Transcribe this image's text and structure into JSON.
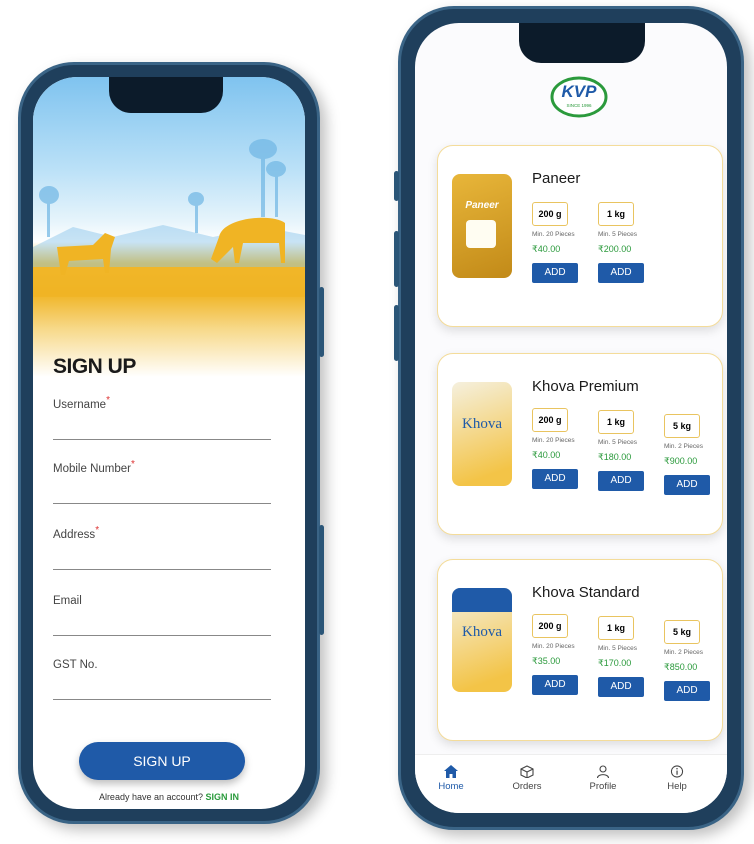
{
  "signup": {
    "title": "SIGN UP",
    "fields": [
      {
        "label": "Username",
        "required": "*"
      },
      {
        "label": "Mobile Number",
        "required": "*"
      },
      {
        "label": "Address",
        "required": "*"
      },
      {
        "label": "Email",
        "required": ""
      },
      {
        "label": "GST No.",
        "required": ""
      }
    ],
    "button_label": "SIGN UP",
    "account_prompt": "Already have an account?",
    "signin_link": "SIGN IN"
  },
  "brand": {
    "logo_text": "KVP",
    "logo_since": "SINCE 1996",
    "colors": {
      "primary": "#1f5aa8",
      "accent_green": "#2b9a3c",
      "card_border": "#f4dc9a",
      "frame": "#1f3f5c"
    }
  },
  "products": [
    {
      "name": "Paneer",
      "pack_label": "Paneer",
      "variants": [
        {
          "size": "200 g",
          "min": "Min. 20 Pieces",
          "price": "₹40.00",
          "add_label": "ADD"
        },
        {
          "size": "1 kg",
          "min": "Min. 5 Pieces",
          "price": "₹200.00",
          "add_label": "ADD"
        }
      ]
    },
    {
      "name": "Khova Premium",
      "pack_label": "Khova",
      "variants": [
        {
          "size": "200 g",
          "min": "Min. 20 Pieces",
          "price": "₹40.00",
          "add_label": "ADD"
        },
        {
          "size": "1 kg",
          "min": "Min. 5 Pieces",
          "price": "₹180.00",
          "add_label": "ADD"
        },
        {
          "size": "5 kg",
          "min": "Min. 2 Pieces",
          "price": "₹900.00",
          "add_label": "ADD"
        }
      ]
    },
    {
      "name": "Khova Standard",
      "pack_label": "Khova",
      "variants": [
        {
          "size": "200 g",
          "min": "Min. 20 Pieces",
          "price": "₹35.00",
          "add_label": "ADD"
        },
        {
          "size": "1 kg",
          "min": "Min. 5 Pieces",
          "price": "₹170.00",
          "add_label": "ADD"
        },
        {
          "size": "5 kg",
          "min": "Min. 2 Pieces",
          "price": "₹850.00",
          "add_label": "ADD"
        }
      ]
    }
  ],
  "tabs": [
    {
      "label": "Home",
      "icon": "home-icon",
      "active": true
    },
    {
      "label": "Orders",
      "icon": "box-icon",
      "active": false
    },
    {
      "label": "Profile",
      "icon": "user-icon",
      "active": false
    },
    {
      "label": "Help",
      "icon": "info-icon",
      "active": false
    }
  ]
}
